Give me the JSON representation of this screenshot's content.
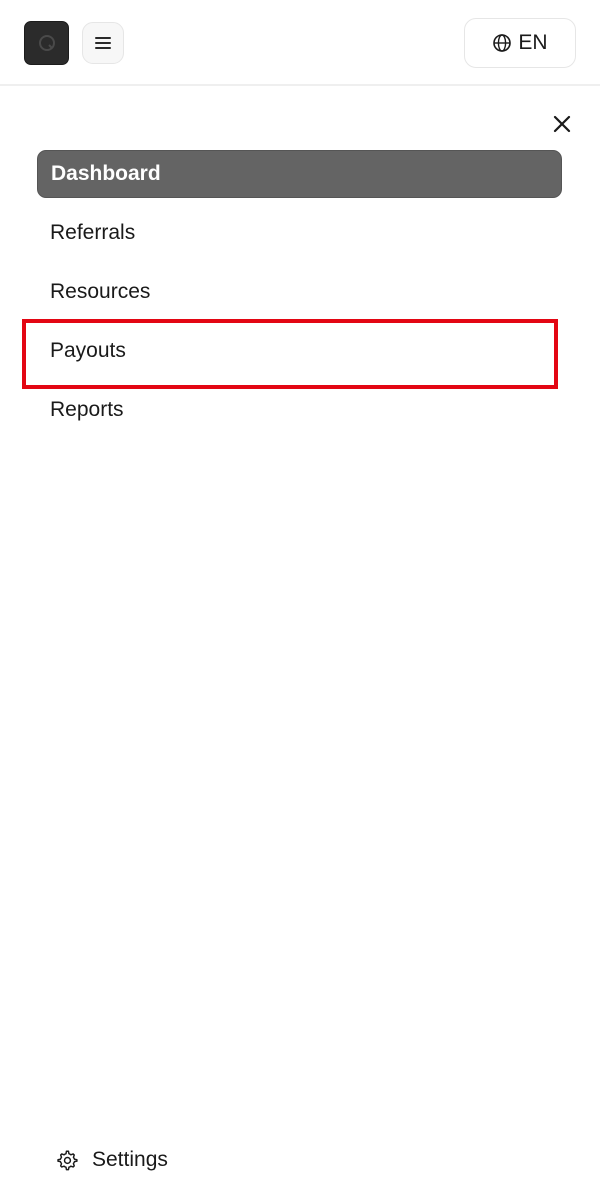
{
  "header": {
    "language_label": "EN",
    "icons": {
      "logo": "brand-logo",
      "menu": "hamburger-menu-icon",
      "language": "globe-icon"
    }
  },
  "drawer": {
    "close_icon": "close-icon",
    "nav_items": [
      {
        "label": "Dashboard",
        "active": true
      },
      {
        "label": "Referrals",
        "active": false
      },
      {
        "label": "Resources",
        "active": false
      },
      {
        "label": "Payouts",
        "active": false,
        "highlighted": true
      },
      {
        "label": "Reports",
        "active": false
      }
    ],
    "settings_label": "Settings",
    "settings_icon": "gear-icon"
  },
  "colors": {
    "active_item_bg": "#646464",
    "highlight": "#e30613",
    "logo_bg": "#2b2b2b"
  }
}
